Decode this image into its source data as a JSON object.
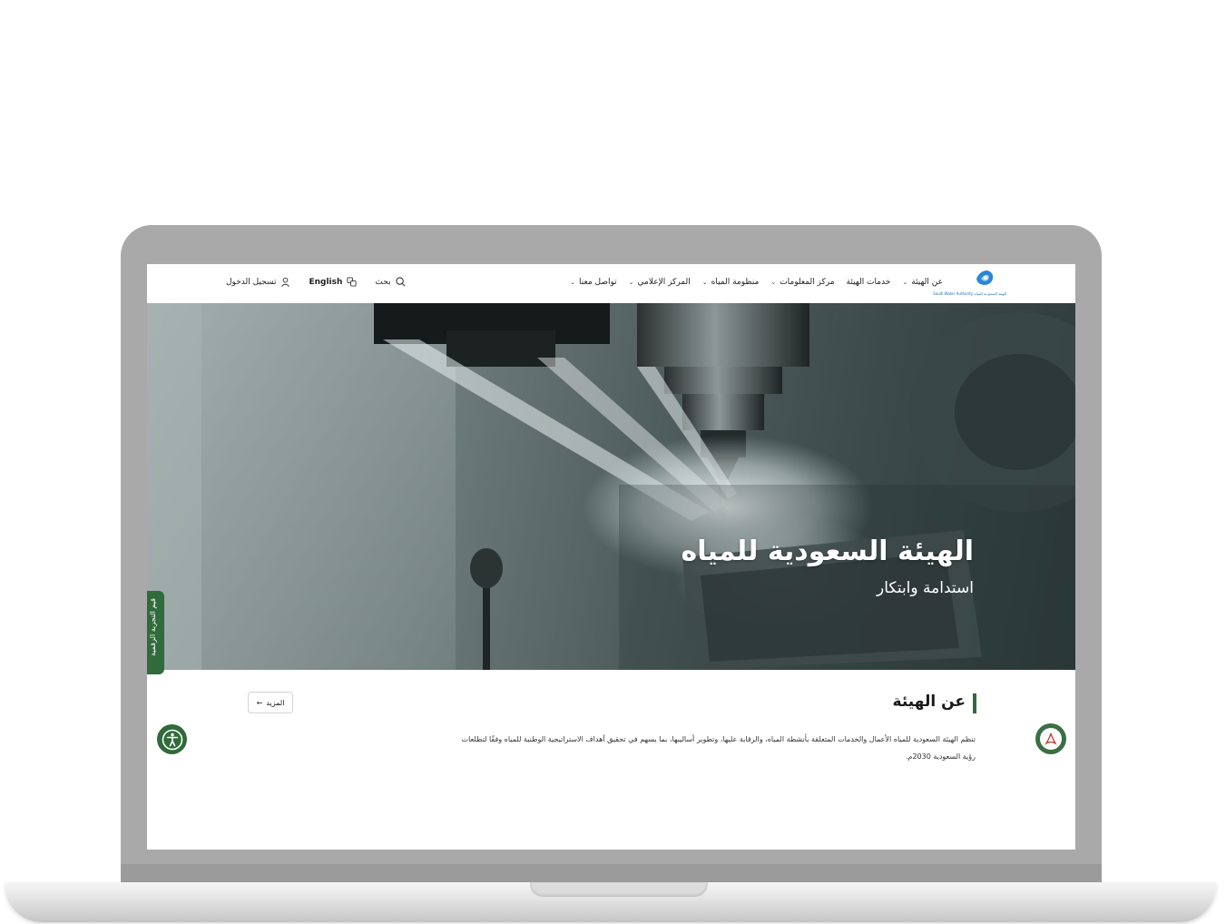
{
  "brand": {
    "logo_text": "الهيئة السعودية للمياه Saudi Water Authority",
    "accent_color": "#2f6b3b",
    "logo_color": "#1d6fb8"
  },
  "nav": {
    "items": [
      {
        "label": "عن الهيئة",
        "has_dropdown": true
      },
      {
        "label": "خدمات الهيئة",
        "has_dropdown": false
      },
      {
        "label": "مركز المعلومات",
        "has_dropdown": true
      },
      {
        "label": "منظومة المياه",
        "has_dropdown": true
      },
      {
        "label": "المركز الإعلامي",
        "has_dropdown": true
      },
      {
        "label": "تواصل معنا",
        "has_dropdown": true
      }
    ],
    "search_label": "بحث",
    "language_label": "English",
    "login_label": "تسجيل الدخول"
  },
  "hero": {
    "title": "الهيئة السعودية للمياه",
    "subtitle": "استدامة وابتكار",
    "side_tab_label": "قيم التجربة الرقمية"
  },
  "about": {
    "title": "عن الهيئة",
    "more_label": "المزيد",
    "text": "تنظم الهيئة السعودية للمياه الأعمال والخدمات المتعلقة بأنشطة المياه، والرقابة عليها، وتطوير أساليبها، بما يسهم في تحقيق أهداف الاستراتيجية الوطنية للمياه وفقًا لتطلعات رؤية السعودية 2030م."
  }
}
